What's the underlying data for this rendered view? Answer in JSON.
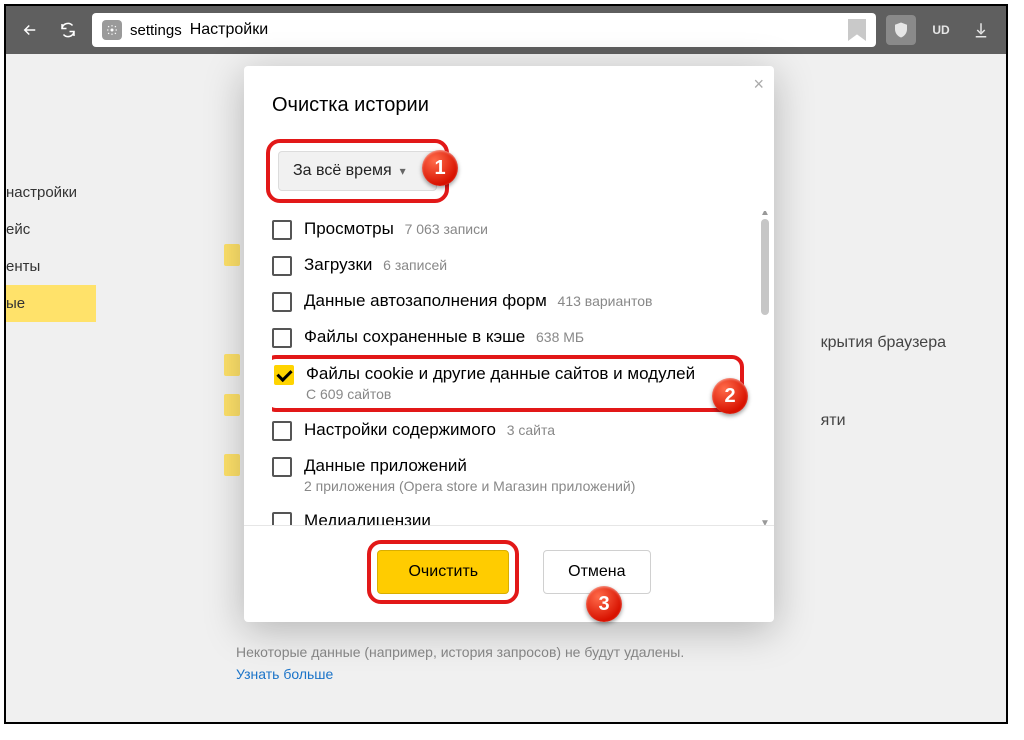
{
  "toolbar": {
    "address_prefix": "settings",
    "address_text": "Настройки"
  },
  "sidebar": {
    "items": [
      {
        "label": "настройки"
      },
      {
        "label": "ейс"
      },
      {
        "label": "енты"
      },
      {
        "label": "ые"
      }
    ]
  },
  "bg_right": {
    "line1": "крытия браузера",
    "line2": "яти"
  },
  "modal": {
    "title": "Очистка истории",
    "range_label": "За всё время",
    "items": [
      {
        "label": "Просмотры",
        "sub": "7 063 записи",
        "checked": false
      },
      {
        "label": "Загрузки",
        "sub": "6 записей",
        "checked": false
      },
      {
        "label": "Данные автозаполнения форм",
        "sub": "413 вариантов",
        "checked": false
      },
      {
        "label": "Файлы сохраненные в кэше",
        "sub": "638 МБ",
        "checked": false
      },
      {
        "label": "Файлы cookie и другие данные сайтов и модулей",
        "sub": "С 609 сайтов",
        "checked": true,
        "sub_block": true,
        "highlight": true
      },
      {
        "label": "Настройки содержимого",
        "sub": "3 сайта",
        "checked": false
      },
      {
        "label": "Данные приложений",
        "sub": "2 приложения (Opera store и Магазин приложений)",
        "checked": false,
        "sub_block": true
      },
      {
        "label": "Медиалицензии",
        "sub": "",
        "checked": false
      }
    ],
    "primary_button": "Очистить",
    "cancel_button": "Отмена"
  },
  "footer": {
    "note": "Некоторые данные (например, история запросов) не будут удалены.",
    "link": "Узнать больше"
  },
  "callouts": {
    "c1": "1",
    "c2": "2",
    "c3": "3"
  }
}
